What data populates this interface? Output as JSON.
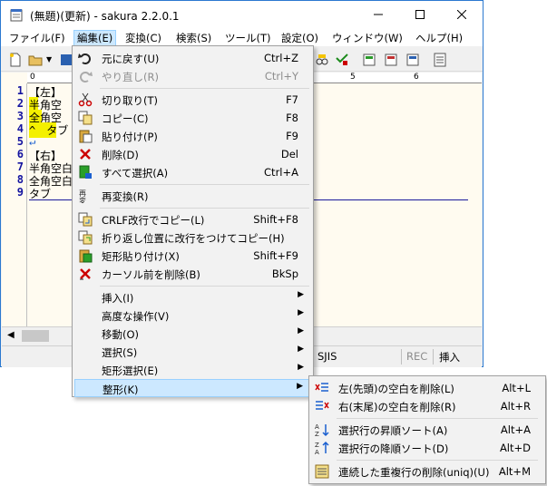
{
  "window": {
    "title": "(無題)(更新) - sakura 2.2.0.1"
  },
  "menubar": {
    "items": [
      {
        "label": "ファイル(F)"
      },
      {
        "label": "編集(E)"
      },
      {
        "label": "変換(C)"
      },
      {
        "label": "検索(S)"
      },
      {
        "label": "ツール(T)"
      },
      {
        "label": "設定(O)"
      },
      {
        "label": "ウィンドウ(W)"
      },
      {
        "label": "ヘルプ(H)"
      }
    ]
  },
  "ruler": {
    "marks": [
      "0",
      "5",
      "6"
    ]
  },
  "editor": {
    "line_numbers": [
      "1",
      "2",
      "3",
      "4",
      "5",
      "6",
      "7",
      "8",
      "9"
    ],
    "lines": [
      "【左】",
      "半角空",
      "全角空",
      "^　タブ",
      "↵",
      "【右】",
      "半角空白",
      "全角空白",
      "タブ"
    ]
  },
  "status": {
    "encoding": "SJIS",
    "rec": "REC",
    "mode": "挿入"
  },
  "edit_menu": {
    "items": [
      {
        "label": "元に戻す(U)",
        "shortcut": "Ctrl+Z"
      },
      {
        "label": "やり直し(R)",
        "shortcut": "Ctrl+Y"
      },
      {
        "label": "切り取り(T)",
        "shortcut": "F7"
      },
      {
        "label": "コピー(C)",
        "shortcut": "F8"
      },
      {
        "label": "貼り付け(P)",
        "shortcut": "F9"
      },
      {
        "label": "削除(D)",
        "shortcut": "Del"
      },
      {
        "label": "すべて選択(A)",
        "shortcut": "Ctrl+A"
      },
      {
        "label": "再変換(R)",
        "shortcut": ""
      },
      {
        "label": "CRLF改行でコピー(L)",
        "shortcut": "Shift+F8"
      },
      {
        "label": "折り返し位置に改行をつけてコピー(H)",
        "shortcut": ""
      },
      {
        "label": "矩形貼り付け(X)",
        "shortcut": "Shift+F9"
      },
      {
        "label": "カーソル前を削除(B)",
        "shortcut": "BkSp"
      },
      {
        "label": "挿入(I)",
        "shortcut": ""
      },
      {
        "label": "高度な操作(V)",
        "shortcut": ""
      },
      {
        "label": "移動(O)",
        "shortcut": ""
      },
      {
        "label": "選択(S)",
        "shortcut": ""
      },
      {
        "label": "矩形選択(E)",
        "shortcut": ""
      },
      {
        "label": "整形(K)",
        "shortcut": ""
      }
    ]
  },
  "seikei_menu": {
    "items": [
      {
        "label": "左(先頭)の空白を削除(L)",
        "shortcut": "Alt+L"
      },
      {
        "label": "右(末尾)の空白を削除(R)",
        "shortcut": "Alt+R"
      },
      {
        "label": "選択行の昇順ソート(A)",
        "shortcut": "Alt+A"
      },
      {
        "label": "選択行の降順ソート(D)",
        "shortcut": "Alt+D"
      },
      {
        "label": "連続した重複行の削除(uniq)(U)",
        "shortcut": "Alt+M"
      }
    ]
  },
  "colors": {
    "highlight": "#cce8ff",
    "line_number": "#1414a0",
    "editor_bg": "#fffbf0",
    "window_border": "#2b79d0"
  }
}
